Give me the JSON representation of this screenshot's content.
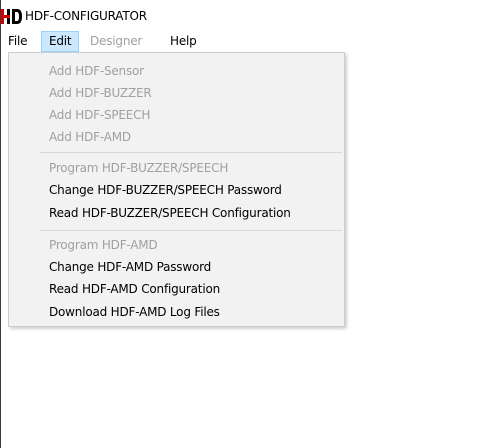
{
  "window": {
    "title": "HDF-CONFIGURATOR",
    "logo_text": "HD"
  },
  "menubar": {
    "items": [
      {
        "label": "File",
        "enabled": true
      },
      {
        "label": "Edit",
        "enabled": true,
        "active": true
      },
      {
        "label": "Designer",
        "enabled": false
      },
      {
        "label": "Help",
        "enabled": true
      }
    ]
  },
  "edit_menu": {
    "items": [
      {
        "label": "Add HDF-Sensor",
        "enabled": false
      },
      {
        "label": "Add HDF-BUZZER",
        "enabled": false
      },
      {
        "label": "Add HDF-SPEECH",
        "enabled": false
      },
      {
        "label": "Add HDF-AMD",
        "enabled": false
      },
      {
        "label": "Program HDF-BUZZER/SPEECH",
        "enabled": false
      },
      {
        "label": "Change HDF-BUZZER/SPEECH Password",
        "enabled": true
      },
      {
        "label": "Read HDF-BUZZER/SPEECH Configuration",
        "enabled": true
      },
      {
        "label": "Program HDF-AMD",
        "enabled": false
      },
      {
        "label": "Change HDF-AMD Password",
        "enabled": true
      },
      {
        "label": "Read HDF-AMD Configuration",
        "enabled": true
      },
      {
        "label": "Download HDF-AMD Log Files",
        "enabled": true
      }
    ]
  },
  "colors": {
    "logo_red": "#d40000",
    "active_menu_bg": "#cce8ff",
    "active_menu_border": "#99d1ff",
    "disabled_text": "#a0a0a0",
    "dropdown_bg": "#f2f2f2"
  }
}
